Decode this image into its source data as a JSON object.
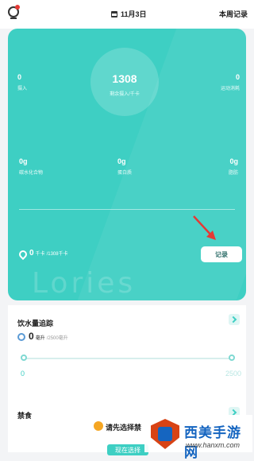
{
  "header": {
    "date": "11月3日",
    "weekly_record": "本周记录"
  },
  "summary": {
    "kcal_value": "1308",
    "kcal_label": "剩余摄入/千卡",
    "intake_value": "0",
    "intake_label": "摄入",
    "burn_value": "0",
    "burn_label": "运动消耗",
    "carbs_value": "0g",
    "carbs_label": "碳水化合物",
    "protein_value": "0g",
    "protein_label": "蛋白质",
    "fat_value": "0g",
    "fat_label": "脂肪",
    "consumed_value": "0",
    "consumed_unit": "千卡",
    "consumed_total": "/1308千卡",
    "record_button": "记录",
    "watermark": "Lories"
  },
  "water": {
    "title": "饮水量追踪",
    "value": "0",
    "unit": "毫升",
    "target": "/2500毫升",
    "slider_min": "0",
    "slider_max": "2500",
    "progress": 0
  },
  "fasting": {
    "title": "禁食",
    "prompt": "请先选择禁",
    "start_button": "现在选择"
  },
  "watermark_logo": {
    "cn": "西美手游网",
    "url": "www.hanxm.com"
  },
  "colors": {
    "accent": "#3ecfc3",
    "arrow": "#e53935"
  }
}
